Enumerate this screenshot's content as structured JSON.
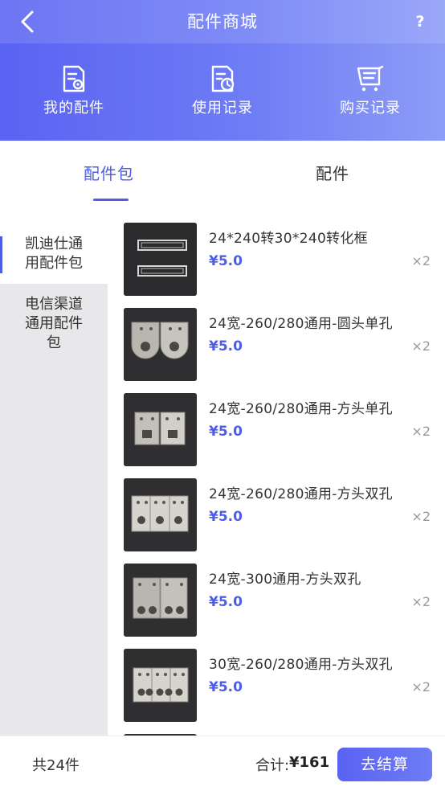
{
  "header": {
    "title": "配件商城",
    "help_label": "?",
    "back_icon": "back-chevron-icon"
  },
  "quick_links": [
    {
      "label": "我的配件",
      "icon": "document-gear-icon"
    },
    {
      "label": "使用记录",
      "icon": "document-clock-icon"
    },
    {
      "label": "购买记录",
      "icon": "cart-icon"
    }
  ],
  "tabs": [
    {
      "label": "配件包",
      "active": true
    },
    {
      "label": "配件",
      "active": false
    }
  ],
  "categories": [
    {
      "label_line1": "凯迪仕通",
      "label_line2": "用配件包",
      "active": true
    },
    {
      "label_line1": "电信渠道",
      "label_line2": "通用配件",
      "label_line3": "包",
      "active": false
    }
  ],
  "items": [
    {
      "name": "24*240转30*240转化框",
      "price": "¥5.0",
      "qty": "×2"
    },
    {
      "name": "24宽-260/280通用-圆头单孔",
      "price": "¥5.0",
      "qty": "×2"
    },
    {
      "name": "24宽-260/280通用-方头单孔",
      "price": "¥5.0",
      "qty": "×2"
    },
    {
      "name": "24宽-260/280通用-方头双孔",
      "price": "¥5.0",
      "qty": "×2"
    },
    {
      "name": "24宽-300通用-方头双孔",
      "price": "¥5.0",
      "qty": "×2"
    },
    {
      "name": "30宽-260/280通用-方头双孔",
      "price": "¥5.0",
      "qty": "×2"
    }
  ],
  "footer": {
    "count": "共24件",
    "total_label": "合计:",
    "total_value": "¥161",
    "checkout_label": "去结算"
  },
  "colors": {
    "accent": "#4c5de8",
    "header_gradient_start": "#5a63f2",
    "header_gradient_end": "#8d9cf7"
  }
}
